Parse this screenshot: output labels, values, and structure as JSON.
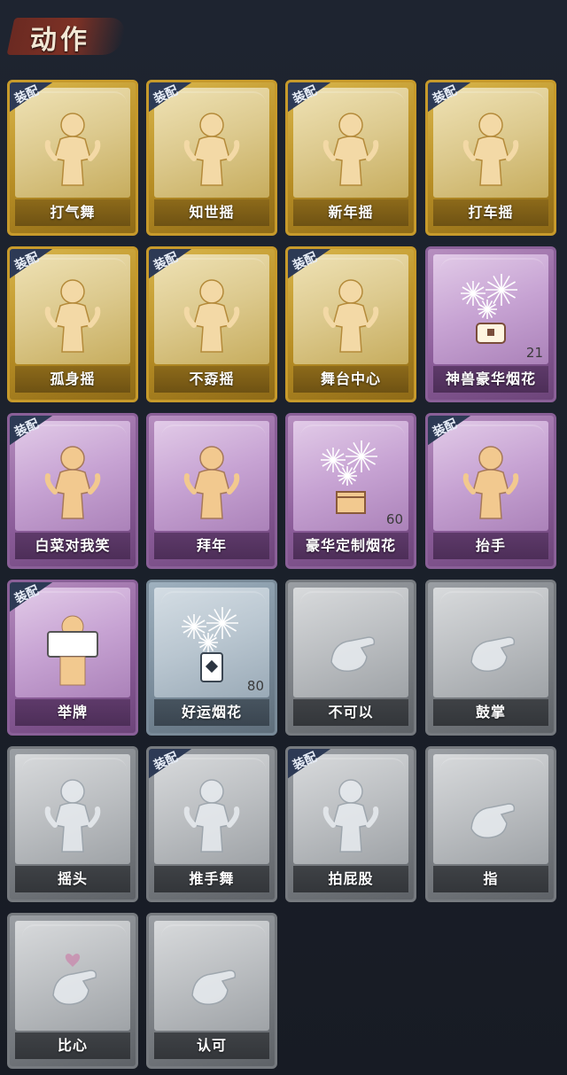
{
  "header": {
    "title": "动作"
  },
  "equip_label": "装配",
  "colors": {
    "gold": "#c79a2b",
    "purple": "#8a6098",
    "blue": "#798a98",
    "grey": "#767a7f",
    "badge": "#2d3a55"
  },
  "cards": [
    {
      "label": "打气舞",
      "rarity": "gold",
      "equipped": true,
      "icon": "dance-figure-icon"
    },
    {
      "label": "知世摇",
      "rarity": "gold",
      "equipped": true,
      "icon": "sway-figure-icon"
    },
    {
      "label": "新年摇",
      "rarity": "gold",
      "equipped": true,
      "icon": "clap-figure-icon"
    },
    {
      "label": "打车摇",
      "rarity": "gold",
      "equipped": true,
      "icon": "hail-figure-icon"
    },
    {
      "label": "孤身摇",
      "rarity": "gold",
      "equipped": true,
      "icon": "solo-sway-figure-icon"
    },
    {
      "label": "不孬摇",
      "rarity": "gold",
      "equipped": true,
      "icon": "point-up-figure-icon"
    },
    {
      "label": "舞台中心",
      "rarity": "gold",
      "equipped": true,
      "icon": "center-stage-figure-icon"
    },
    {
      "label": "神兽豪华烟花",
      "rarity": "purple",
      "equipped": false,
      "icon": "fireworks-bucket-icon",
      "count": "21"
    },
    {
      "label": "白菜对我笑",
      "rarity": "purple",
      "equipped": true,
      "icon": "shy-figure-icon"
    },
    {
      "label": "拜年",
      "rarity": "purple",
      "equipped": false,
      "icon": "greeting-figure-icon"
    },
    {
      "label": "豪华定制烟花",
      "rarity": "purple",
      "equipped": false,
      "icon": "fireworks-box-icon",
      "count": "60"
    },
    {
      "label": "抬手",
      "rarity": "purple",
      "equipped": true,
      "icon": "raise-hand-figure-icon"
    },
    {
      "label": "举牌",
      "rarity": "purple",
      "equipped": true,
      "icon": "hold-sign-figure-icon"
    },
    {
      "label": "好运烟花",
      "rarity": "blue",
      "equipped": false,
      "icon": "firecracker-icon",
      "count": "80"
    },
    {
      "label": "不可以",
      "rarity": "grey",
      "equipped": false,
      "icon": "finger-wag-icon"
    },
    {
      "label": "鼓掌",
      "rarity": "grey",
      "equipped": false,
      "icon": "clap-hands-icon"
    },
    {
      "label": "摇头",
      "rarity": "grey",
      "equipped": false,
      "icon": "shake-head-figure-icon"
    },
    {
      "label": "推手舞",
      "rarity": "grey",
      "equipped": true,
      "icon": "push-dance-figure-icon"
    },
    {
      "label": "拍屁股",
      "rarity": "grey",
      "equipped": true,
      "icon": "slap-figure-icon"
    },
    {
      "label": "指",
      "rarity": "grey",
      "equipped": false,
      "icon": "point-hand-icon"
    },
    {
      "label": "比心",
      "rarity": "grey",
      "equipped": false,
      "icon": "finger-heart-icon"
    },
    {
      "label": "认可",
      "rarity": "grey",
      "equipped": false,
      "icon": "thumbs-up-icon"
    }
  ]
}
